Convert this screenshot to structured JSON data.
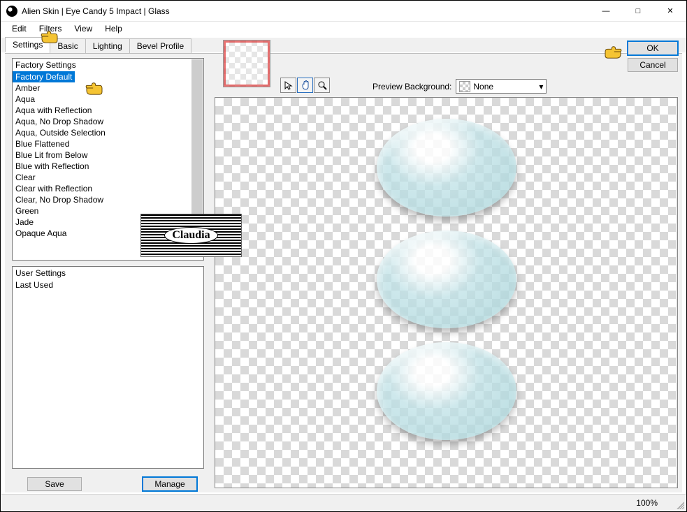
{
  "window": {
    "title": "Alien Skin | Eye Candy 5 Impact | Glass"
  },
  "menu": {
    "items": [
      "Edit",
      "Filters",
      "View",
      "Help"
    ]
  },
  "tabs": {
    "items": [
      "Settings",
      "Basic",
      "Lighting",
      "Bevel Profile"
    ],
    "active": 0
  },
  "factory": {
    "header": "Factory Settings",
    "items": [
      "Factory Default",
      "Amber",
      "Aqua",
      "Aqua with Reflection",
      "Aqua, No Drop Shadow",
      "Aqua, Outside Selection",
      "Blue Flattened",
      "Blue Lit from Below",
      "Blue with Reflection",
      "Clear",
      "Clear with Reflection",
      "Clear, No Drop Shadow",
      "Green",
      "Jade",
      "Opaque Aqua"
    ],
    "selected": 0
  },
  "user": {
    "header": "User Settings",
    "items": [
      "Last Used"
    ]
  },
  "buttons": {
    "save": "Save",
    "manage": "Manage",
    "ok": "OK",
    "cancel": "Cancel"
  },
  "preview": {
    "bg_label": "Preview Background:",
    "bg_value": "None"
  },
  "status": {
    "zoom": "100%"
  },
  "watermark": "Claudia"
}
